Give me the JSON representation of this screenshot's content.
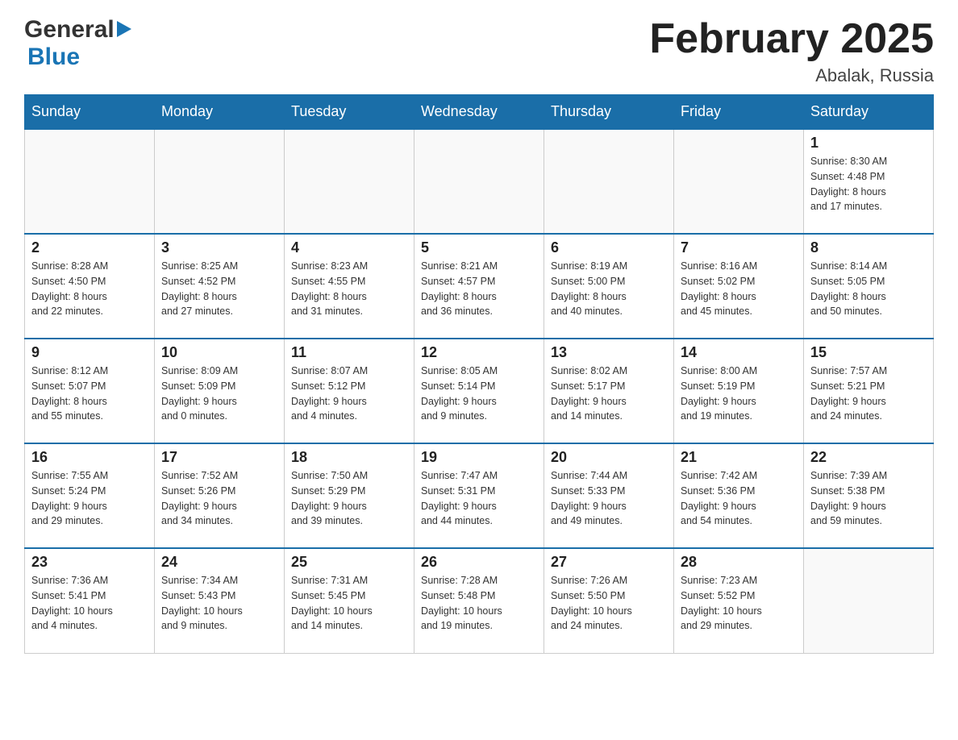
{
  "header": {
    "logo_general": "General",
    "logo_blue": "Blue",
    "month_title": "February 2025",
    "location": "Abalak, Russia"
  },
  "weekdays": [
    "Sunday",
    "Monday",
    "Tuesday",
    "Wednesday",
    "Thursday",
    "Friday",
    "Saturday"
  ],
  "weeks": [
    {
      "days": [
        {
          "date": "",
          "info": ""
        },
        {
          "date": "",
          "info": ""
        },
        {
          "date": "",
          "info": ""
        },
        {
          "date": "",
          "info": ""
        },
        {
          "date": "",
          "info": ""
        },
        {
          "date": "",
          "info": ""
        },
        {
          "date": "1",
          "info": "Sunrise: 8:30 AM\nSunset: 4:48 PM\nDaylight: 8 hours\nand 17 minutes."
        }
      ]
    },
    {
      "days": [
        {
          "date": "2",
          "info": "Sunrise: 8:28 AM\nSunset: 4:50 PM\nDaylight: 8 hours\nand 22 minutes."
        },
        {
          "date": "3",
          "info": "Sunrise: 8:25 AM\nSunset: 4:52 PM\nDaylight: 8 hours\nand 27 minutes."
        },
        {
          "date": "4",
          "info": "Sunrise: 8:23 AM\nSunset: 4:55 PM\nDaylight: 8 hours\nand 31 minutes."
        },
        {
          "date": "5",
          "info": "Sunrise: 8:21 AM\nSunset: 4:57 PM\nDaylight: 8 hours\nand 36 minutes."
        },
        {
          "date": "6",
          "info": "Sunrise: 8:19 AM\nSunset: 5:00 PM\nDaylight: 8 hours\nand 40 minutes."
        },
        {
          "date": "7",
          "info": "Sunrise: 8:16 AM\nSunset: 5:02 PM\nDaylight: 8 hours\nand 45 minutes."
        },
        {
          "date": "8",
          "info": "Sunrise: 8:14 AM\nSunset: 5:05 PM\nDaylight: 8 hours\nand 50 minutes."
        }
      ]
    },
    {
      "days": [
        {
          "date": "9",
          "info": "Sunrise: 8:12 AM\nSunset: 5:07 PM\nDaylight: 8 hours\nand 55 minutes."
        },
        {
          "date": "10",
          "info": "Sunrise: 8:09 AM\nSunset: 5:09 PM\nDaylight: 9 hours\nand 0 minutes."
        },
        {
          "date": "11",
          "info": "Sunrise: 8:07 AM\nSunset: 5:12 PM\nDaylight: 9 hours\nand 4 minutes."
        },
        {
          "date": "12",
          "info": "Sunrise: 8:05 AM\nSunset: 5:14 PM\nDaylight: 9 hours\nand 9 minutes."
        },
        {
          "date": "13",
          "info": "Sunrise: 8:02 AM\nSunset: 5:17 PM\nDaylight: 9 hours\nand 14 minutes."
        },
        {
          "date": "14",
          "info": "Sunrise: 8:00 AM\nSunset: 5:19 PM\nDaylight: 9 hours\nand 19 minutes."
        },
        {
          "date": "15",
          "info": "Sunrise: 7:57 AM\nSunset: 5:21 PM\nDaylight: 9 hours\nand 24 minutes."
        }
      ]
    },
    {
      "days": [
        {
          "date": "16",
          "info": "Sunrise: 7:55 AM\nSunset: 5:24 PM\nDaylight: 9 hours\nand 29 minutes."
        },
        {
          "date": "17",
          "info": "Sunrise: 7:52 AM\nSunset: 5:26 PM\nDaylight: 9 hours\nand 34 minutes."
        },
        {
          "date": "18",
          "info": "Sunrise: 7:50 AM\nSunset: 5:29 PM\nDaylight: 9 hours\nand 39 minutes."
        },
        {
          "date": "19",
          "info": "Sunrise: 7:47 AM\nSunset: 5:31 PM\nDaylight: 9 hours\nand 44 minutes."
        },
        {
          "date": "20",
          "info": "Sunrise: 7:44 AM\nSunset: 5:33 PM\nDaylight: 9 hours\nand 49 minutes."
        },
        {
          "date": "21",
          "info": "Sunrise: 7:42 AM\nSunset: 5:36 PM\nDaylight: 9 hours\nand 54 minutes."
        },
        {
          "date": "22",
          "info": "Sunrise: 7:39 AM\nSunset: 5:38 PM\nDaylight: 9 hours\nand 59 minutes."
        }
      ]
    },
    {
      "days": [
        {
          "date": "23",
          "info": "Sunrise: 7:36 AM\nSunset: 5:41 PM\nDaylight: 10 hours\nand 4 minutes."
        },
        {
          "date": "24",
          "info": "Sunrise: 7:34 AM\nSunset: 5:43 PM\nDaylight: 10 hours\nand 9 minutes."
        },
        {
          "date": "25",
          "info": "Sunrise: 7:31 AM\nSunset: 5:45 PM\nDaylight: 10 hours\nand 14 minutes."
        },
        {
          "date": "26",
          "info": "Sunrise: 7:28 AM\nSunset: 5:48 PM\nDaylight: 10 hours\nand 19 minutes."
        },
        {
          "date": "27",
          "info": "Sunrise: 7:26 AM\nSunset: 5:50 PM\nDaylight: 10 hours\nand 24 minutes."
        },
        {
          "date": "28",
          "info": "Sunrise: 7:23 AM\nSunset: 5:52 PM\nDaylight: 10 hours\nand 29 minutes."
        },
        {
          "date": "",
          "info": ""
        }
      ]
    }
  ]
}
